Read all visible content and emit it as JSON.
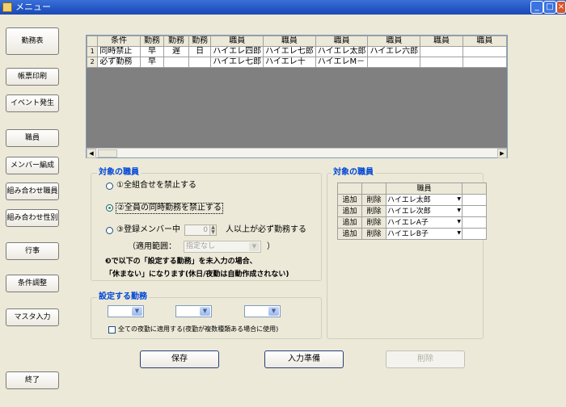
{
  "window": {
    "title": "メニュー"
  },
  "sidebar": {
    "items": [
      {
        "label": "勤務表"
      },
      {
        "label": "帳票印刷"
      },
      {
        "label": "イベント発生"
      },
      {
        "label": "職員"
      },
      {
        "label": "メンバー編成"
      },
      {
        "label": "組み合わせ職員"
      },
      {
        "label": "組み合わせ性別"
      },
      {
        "label": "行事"
      },
      {
        "label": "条件調整"
      },
      {
        "label": "マスタ入力"
      },
      {
        "label": "終了"
      }
    ]
  },
  "grid": {
    "columns": [
      "条件",
      "勤務",
      "勤務",
      "勤務",
      "職員",
      "職員",
      "職員",
      "職員",
      "職員",
      "職員"
    ],
    "rows": [
      {
        "num": "1",
        "cells": [
          "同時禁止",
          "早",
          "遅",
          "日",
          "ハイエレ四郎",
          "ハイエレ七郎",
          "ハイエレ太郎",
          "ハイエレ六郎",
          "",
          ""
        ]
      },
      {
        "num": "2",
        "cells": [
          "必ず勤務",
          "早",
          "",
          "",
          "ハイエレ七郎",
          "ハイエレ十",
          "ハイエレM－",
          "",
          "",
          ""
        ]
      }
    ]
  },
  "target_staff_options": {
    "title": "対象の職員",
    "option1": "①全組合せを禁止する",
    "option2": "②全員の同時勤務を禁止する",
    "option3_prefix": "③登録メンバー中",
    "option3_value": "0",
    "option3_suffix": "人以上が必ず勤務する",
    "range_label": "（適用範囲：",
    "range_value": "指定なし",
    "range_close": "）",
    "note1": "❸で以下の「設定する勤務」を未入力の場合、",
    "note2": "「休まない」になります(休日/夜勤は自動作成されない)"
  },
  "work_settings": {
    "title": "設定する勤務",
    "checkbox_label": "全ての夜勤に適用する(夜勤が複数種類ある場合に使用)"
  },
  "member_panel": {
    "title": "対象の職員",
    "column": "職員",
    "add_label": "追加",
    "delete_label": "削除",
    "rows": [
      "ハイエレ太郎",
      "ハイエレ次郎",
      "ハイエレA子",
      "ハイエレB子"
    ]
  },
  "actions": {
    "save": "保存",
    "prepare": "入力準備",
    "delete": "削除"
  },
  "icons": {
    "dropdown": "chevron-down-icon",
    "minimize": "minimize-icon",
    "maximize": "maximize-icon",
    "close": "close-icon"
  },
  "colors": {
    "titlebar": "#2457c5",
    "group_title": "#0046d5",
    "window_bg": "#ece9d8"
  }
}
